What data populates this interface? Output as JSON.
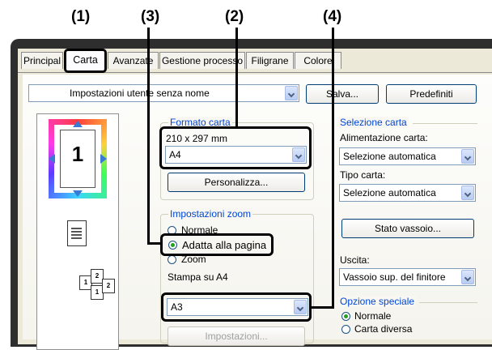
{
  "callouts": [
    "(1)",
    "(2)",
    "(3)",
    "(4)"
  ],
  "tabs": [
    "Principal",
    "Carta",
    "Avanzate",
    "Gestione processo",
    "Filigrane",
    "Colore"
  ],
  "settings": {
    "value": "Impostazioni utente senza nome",
    "save_label": "Salva...",
    "defaults_label": "Predefiniti"
  },
  "paper_format": {
    "legend": "Formato carta",
    "size_text": "210 x 297 mm",
    "selected": "A4",
    "customize_label": "Personalizza..."
  },
  "preview": {
    "page_number": "1",
    "pages_icon": "multi-page-icon"
  },
  "zoom": {
    "legend": "Impostazioni zoom",
    "options": [
      "Normale",
      "Adatta alla pagina",
      "Zoom"
    ],
    "selected_index": 1,
    "print_on_label": "Stampa su A4",
    "fit_size": "A3",
    "settings_label": "Impostazioni..."
  },
  "paper_selection": {
    "legend": "Selezione carta",
    "feed_label": "Alimentazione carta:",
    "feed_value": "Selezione automatica",
    "type_label": "Tipo carta:",
    "type_value": "Selezione automatica",
    "tray_status_label": "Stato vassoio..."
  },
  "output": {
    "label": "Uscita:",
    "value": "Vassoio sup. del finitore"
  },
  "special": {
    "legend": "Opzione speciale",
    "options": [
      "Normale",
      "Carta diversa"
    ],
    "selected_index": 0
  },
  "colors": {
    "accent": "#0046d5",
    "highlight": "#000000"
  }
}
